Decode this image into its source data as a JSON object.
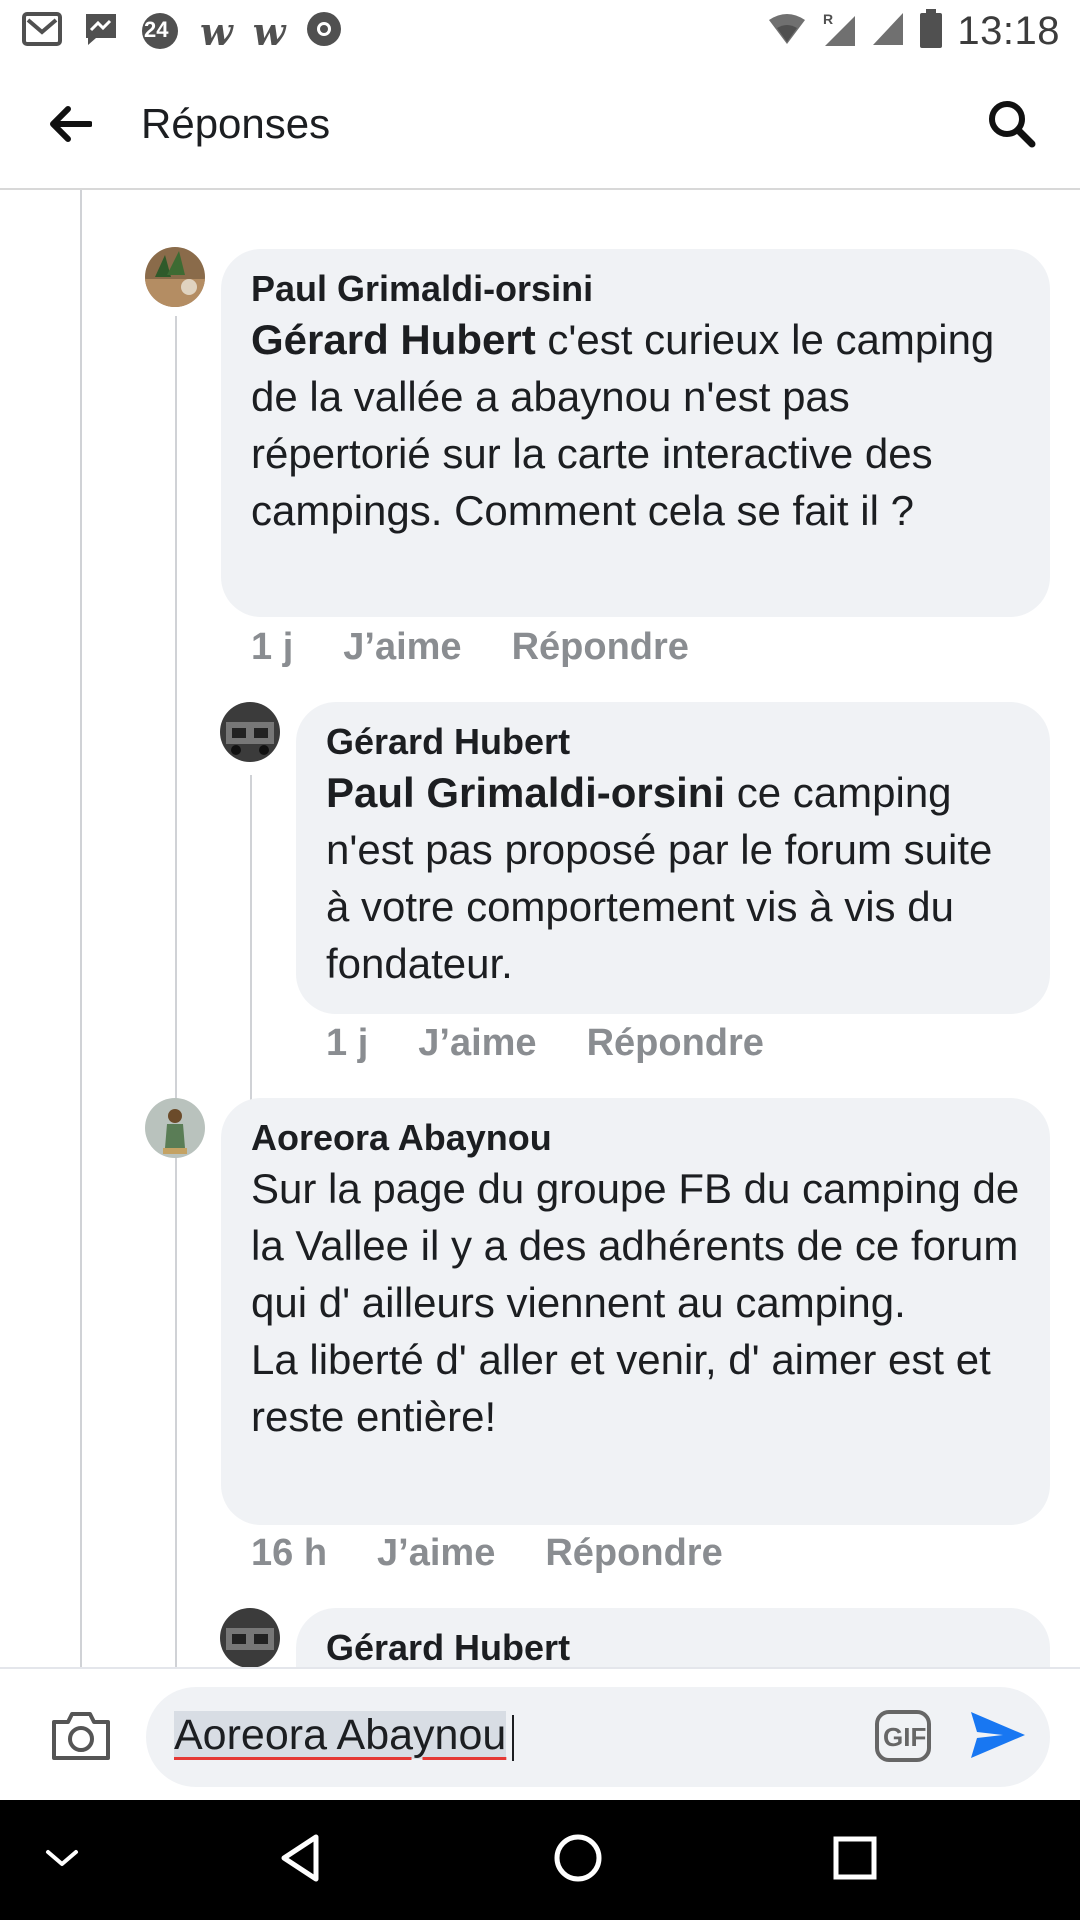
{
  "status_bar": {
    "time": "13:18",
    "badge_24": "24",
    "icons": [
      "gmail-icon",
      "messenger-icon",
      "news-24-icon",
      "w-app-icon",
      "w-app-icon",
      "chrome-icon",
      "wifi-icon",
      "signal-roaming-icon",
      "signal-icon",
      "battery-icon"
    ]
  },
  "header": {
    "title": "Réponses",
    "back_icon": "arrow-left-icon",
    "search_icon": "search-icon"
  },
  "comments": [
    {
      "author": "Paul Grimaldi-orsini",
      "mention": "Gérard Hubert",
      "text": "  c'est curieux le camping de la vallée a abaynou n'est pas répertorié sur la carte interactive des campings.  Comment cela se fait il ?",
      "time": "1 j",
      "like": "J’aime",
      "reply": "Répondre"
    },
    {
      "author": "Gérard Hubert",
      "mention": "Paul Grimaldi-orsini",
      "text": " ce camping n'est pas proposé par le forum suite à votre comportement vis à vis du fondateur.",
      "time": "1 j",
      "like": "J’aime",
      "reply": "Répondre"
    },
    {
      "author": "Aoreora Abaynou",
      "mention": "",
      "text": "Sur la page du groupe FB du camping de la Vallee il y a des adhérents de ce forum  qui d' ailleurs viennent au camping.\nLa liberté d' aller et venir, d' aimer est et reste entière!",
      "time": "16 h",
      "like": "J’aime",
      "reply": "Répondre"
    },
    {
      "author": "Gérard Hubert"
    }
  ],
  "composer": {
    "value": "Aoreora Abaynou",
    "gif_label": "GIF",
    "camera_icon": "camera-icon",
    "send_icon": "send-icon"
  },
  "nav_bar": {
    "icons": [
      "chevron-down-icon",
      "back-triangle-icon",
      "home-circle-icon",
      "recents-square-icon"
    ]
  },
  "colors": {
    "bubble": "#f0f2f5",
    "meta": "#8a8d91",
    "send": "#1877f2",
    "text": "#1c1e21"
  }
}
